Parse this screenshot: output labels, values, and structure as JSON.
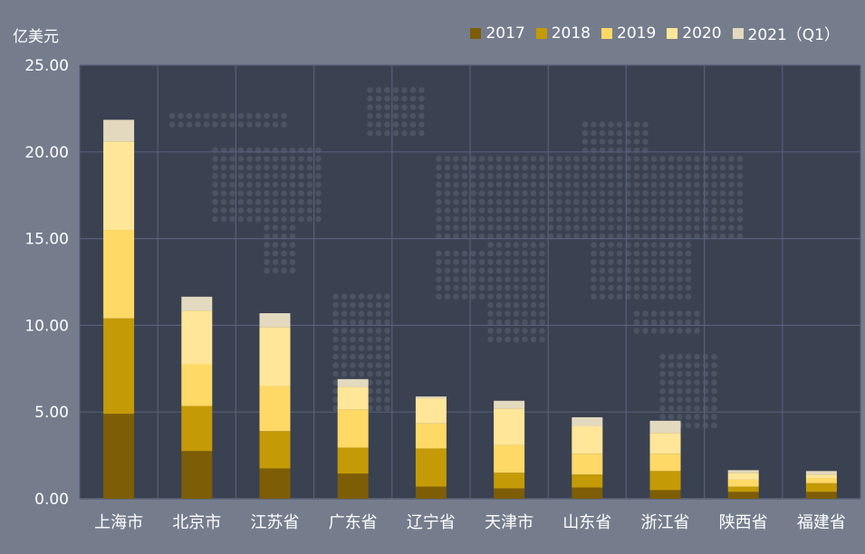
{
  "chart_data": {
    "type": "bar",
    "stacked": true,
    "unit_label": "亿美元",
    "categories": [
      "上海市",
      "北京市",
      "江苏省",
      "广东省",
      "辽宁省",
      "天津市",
      "山东省",
      "浙江省",
      "陕西省",
      "福建省"
    ],
    "series": [
      {
        "name": "2017",
        "color": "#7d5d06",
        "values": [
          4.9,
          2.75,
          1.75,
          1.45,
          0.7,
          0.6,
          0.65,
          0.5,
          0.4,
          0.4
        ]
      },
      {
        "name": "2018",
        "color": "#c49a06",
        "values": [
          5.5,
          2.6,
          2.15,
          1.5,
          2.2,
          0.9,
          0.75,
          1.1,
          0.3,
          0.5
        ]
      },
      {
        "name": "2019",
        "color": "#ffd966",
        "values": [
          5.1,
          2.4,
          2.6,
          2.2,
          1.45,
          1.6,
          1.2,
          1.0,
          0.4,
          0.3
        ]
      },
      {
        "name": "2020",
        "color": "#ffe699",
        "values": [
          5.1,
          3.1,
          3.4,
          1.3,
          1.45,
          2.1,
          1.6,
          1.2,
          0.4,
          0.2
        ]
      },
      {
        "name": "2021（Q1）",
        "color": "#e3d9bf",
        "values": [
          1.25,
          0.8,
          0.8,
          0.45,
          0.1,
          0.45,
          0.5,
          0.7,
          0.15,
          0.2
        ]
      }
    ],
    "ylim": [
      0,
      25
    ],
    "yticks": [
      "0.00",
      "5.00",
      "10.00",
      "15.00",
      "20.00",
      "25.00"
    ],
    "legend_position": "top-right",
    "grid": true
  }
}
